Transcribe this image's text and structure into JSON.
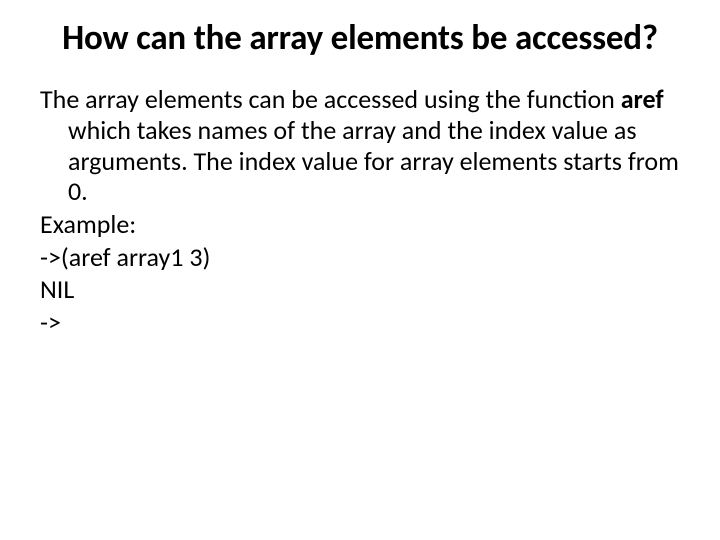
{
  "title": "How can the array elements be accessed?",
  "body": {
    "para_pre": "The array elements can be accessed using the function ",
    "para_bold": "aref",
    "para_post": " which takes names of the array and the index value as arguments. The index value for array elements starts from 0.",
    "line2": "Example:",
    "line3": "->(aref array1 3)",
    "line4": "NIL",
    "line5": "->"
  }
}
